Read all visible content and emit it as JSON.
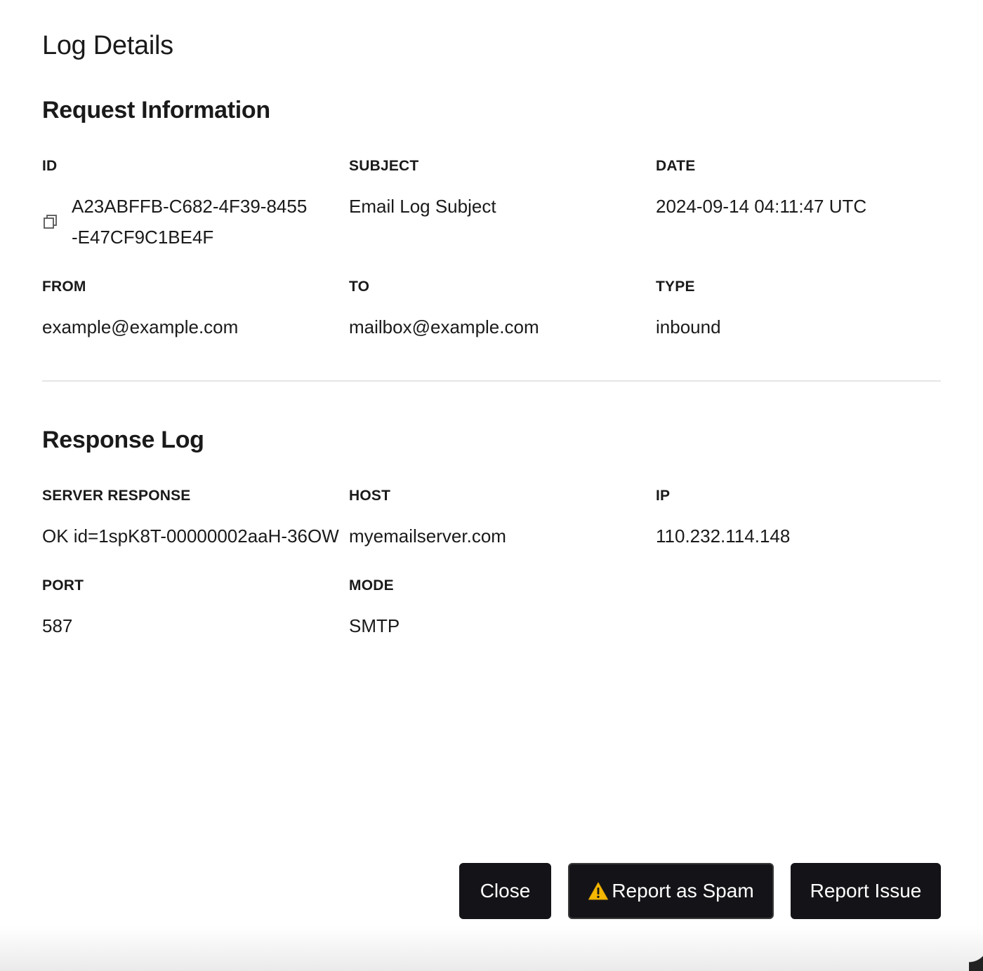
{
  "dialog": {
    "title": "Log Details"
  },
  "request": {
    "title": "Request Information",
    "fields": {
      "id": {
        "label": "ID",
        "value": "A23ABFFB-C682-4F39-8455-E47CF9C1BE4F"
      },
      "subject": {
        "label": "SUBJECT",
        "value": "Email Log Subject"
      },
      "date": {
        "label": "DATE",
        "value": "2024-09-14 04:11:47 UTC"
      },
      "from": {
        "label": "FROM",
        "value": "example@example.com"
      },
      "to": {
        "label": "TO",
        "value": "mailbox@example.com"
      },
      "type": {
        "label": "TYPE",
        "value": "inbound"
      }
    }
  },
  "response": {
    "title": "Response Log",
    "fields": {
      "server_response": {
        "label": "SERVER RESPONSE",
        "value": "OK id=1spK8T-00000002aaH-36OW"
      },
      "host": {
        "label": "HOST",
        "value": "myemailserver.com"
      },
      "ip": {
        "label": "IP",
        "value": "110.232.114.148"
      },
      "port": {
        "label": "PORT",
        "value": "587"
      },
      "mode": {
        "label": "MODE",
        "value": "SMTP"
      }
    }
  },
  "actions": {
    "close": "Close",
    "report_spam": "Report as Spam",
    "report_issue": "Report Issue"
  },
  "icons": {
    "copy": "copy-icon",
    "warning": "warning-icon"
  },
  "colors": {
    "button_bg": "#141418",
    "button_text": "#ffffff",
    "warning": "#f5b800",
    "divider": "#e6e6e6"
  }
}
